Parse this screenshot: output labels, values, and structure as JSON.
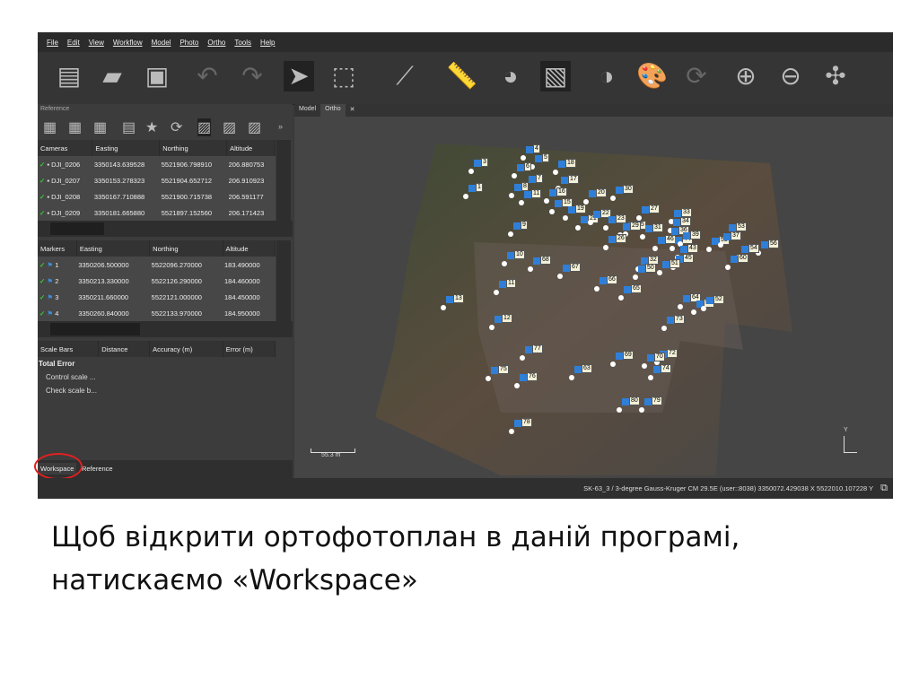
{
  "menu": [
    "File",
    "Edit",
    "View",
    "Workflow",
    "Model",
    "Photo",
    "Ortho",
    "Tools",
    "Help"
  ],
  "reference_panel": {
    "title": "Reference",
    "cameras": {
      "headers": [
        "Cameras",
        "Easting",
        "Northing",
        "Altitude"
      ],
      "rows": [
        [
          "DJI_0206",
          "3350143.639528",
          "5521906.798910",
          "206.880753"
        ],
        [
          "DJI_0207",
          "3350153.278323",
          "5521904.652712",
          "206.910923"
        ],
        [
          "DJI_0208",
          "3350167.710888",
          "5521900.715738",
          "206.591177"
        ],
        [
          "DJI_0209",
          "3350181.665880",
          "5521897.152560",
          "206.171423"
        ]
      ]
    },
    "markers": {
      "headers": [
        "Markers",
        "Easting",
        "Northing",
        "Altitude"
      ],
      "rows": [
        [
          "1",
          "3350206.500000",
          "5522096.270000",
          "183.490000"
        ],
        [
          "2",
          "3350213.330000",
          "5522126.290000",
          "184.460000"
        ],
        [
          "3",
          "3350211.660000",
          "5522121.000000",
          "184.450000"
        ],
        [
          "4",
          "3350260.840000",
          "5522133.970000",
          "184.950000"
        ]
      ]
    },
    "scale_bars": {
      "headers": [
        "Scale Bars",
        "Distance",
        "Accuracy (m)",
        "Error (m)"
      ],
      "total": "Total Error",
      "items": [
        "Control scale ...",
        "Check scale b..."
      ]
    }
  },
  "bottom_tabs": [
    "Workspace",
    "Reference"
  ],
  "view_tabs": [
    "Model",
    "Ortho"
  ],
  "scale_label": "55.3 m",
  "axis_label": "Y",
  "marker_labels": [
    "3",
    "4",
    "5",
    "18",
    "1",
    "6",
    "7",
    "8",
    "11",
    "17",
    "16",
    "20",
    "30",
    "15",
    "19",
    "21",
    "22",
    "27",
    "33",
    "23",
    "34",
    "25",
    "29",
    "31",
    "36",
    "53",
    "9",
    "26",
    "46",
    "44",
    "39",
    "55",
    "56",
    "37",
    "43",
    "54",
    "10",
    "68",
    "32",
    "45",
    "60",
    "67",
    "51",
    "50",
    "11",
    "66",
    "65",
    "13",
    "64",
    "53",
    "52",
    "12",
    "73",
    "77",
    "69",
    "72",
    "70",
    "75",
    "76",
    "74",
    "63",
    "80",
    "79",
    "78"
  ],
  "status": "SK-63_3 / 3-degree Gauss-Kruger CM 29.5E (user::8038)  3350072.429038 X  5522010.107228 Y",
  "caption": "Щоб відкрити ортофотоплан в даній програмі, натискаємо «Workspace»",
  "colors": {
    "highlight": "#e02020",
    "marker": "#2f7fd8"
  }
}
